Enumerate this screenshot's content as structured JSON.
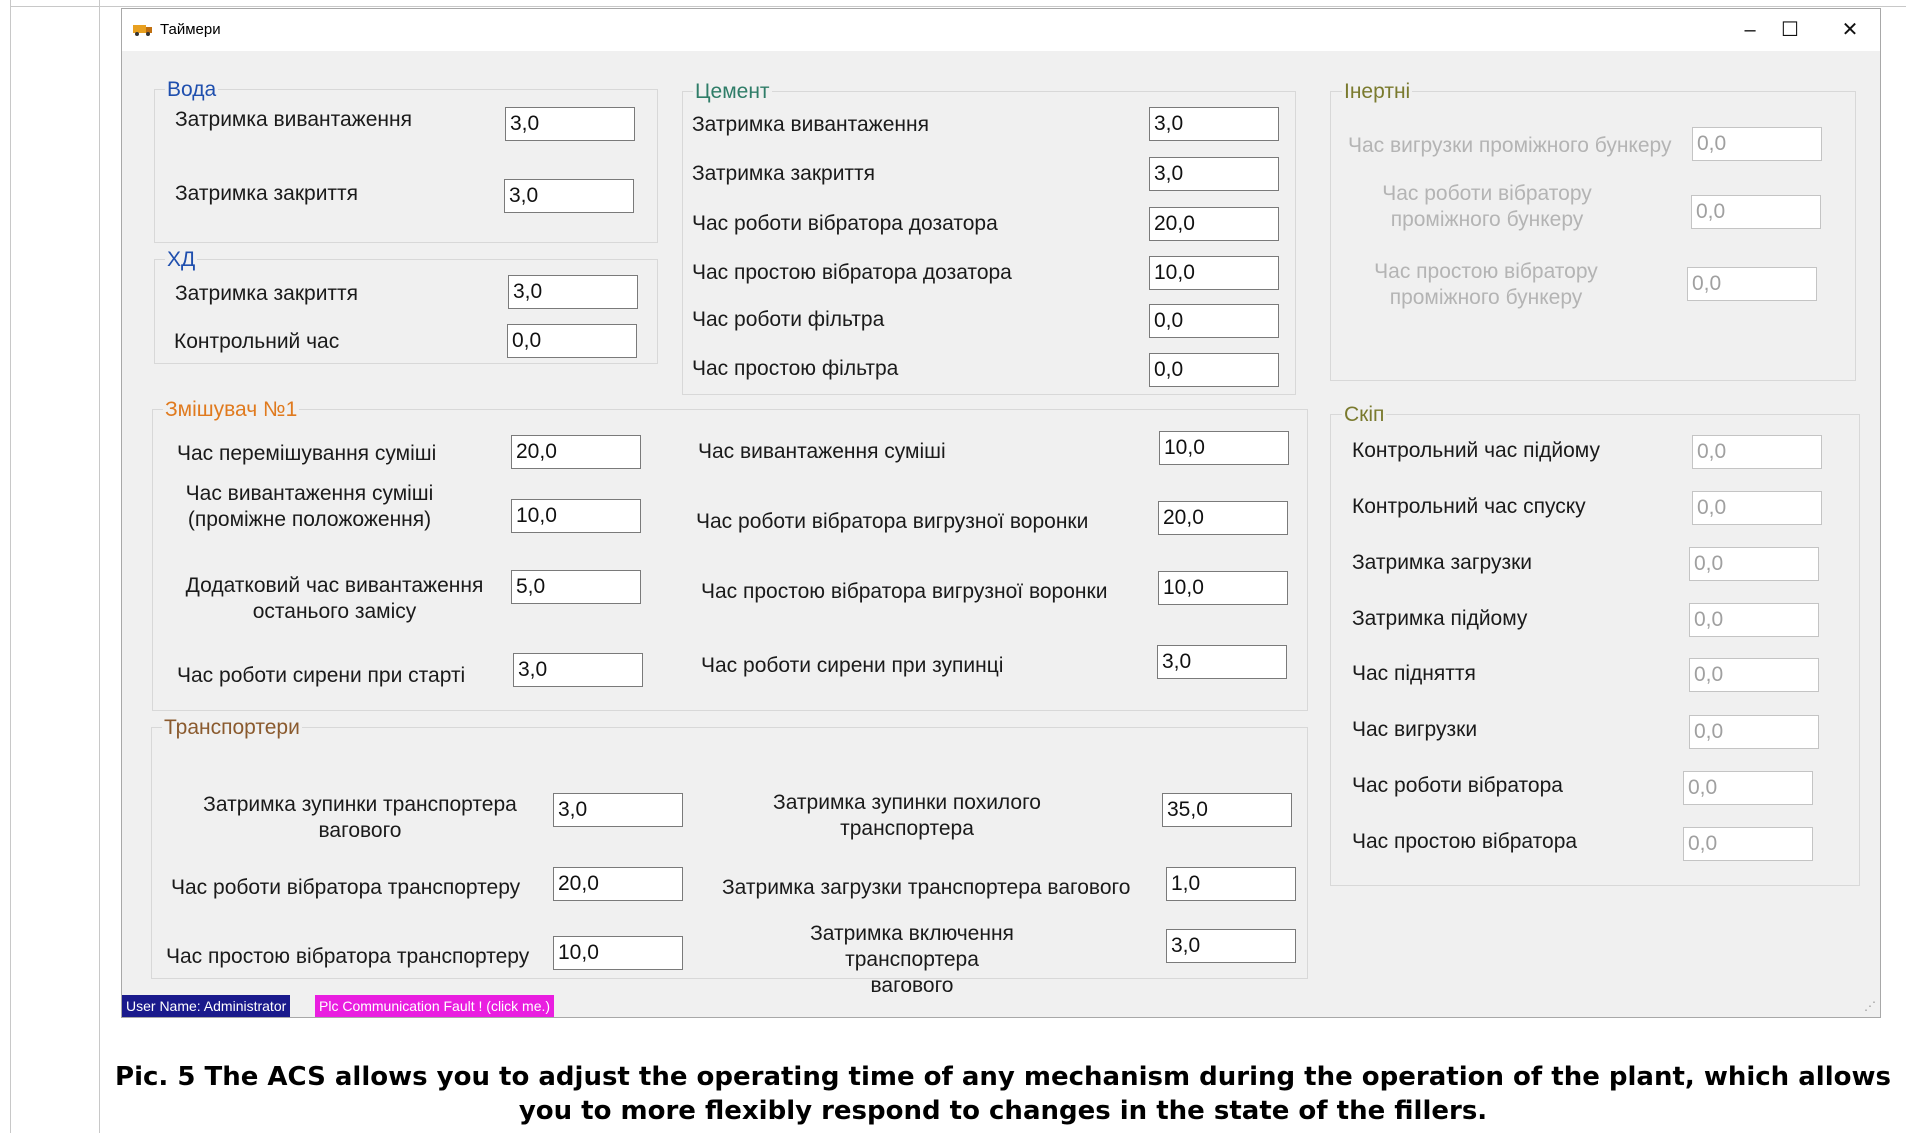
{
  "window": {
    "title": "Таймери",
    "minimize": "–",
    "maximize": "☐",
    "close": "✕"
  },
  "water": {
    "title": "Вода",
    "fields": [
      {
        "label": "Затримка вивантаження",
        "value": "3,0"
      },
      {
        "label": "Затримка закриття",
        "value": "3,0"
      }
    ]
  },
  "hd": {
    "title": "ХД",
    "fields": [
      {
        "label": "Затримка закриття",
        "value": "3,0"
      },
      {
        "label": "Контрольний час",
        "value": "0,0"
      }
    ]
  },
  "cement": {
    "title": "Цемент",
    "fields": [
      {
        "label": "Затримка вивантаження",
        "value": "3,0"
      },
      {
        "label": "Затримка закриття",
        "value": "3,0"
      },
      {
        "label": "Час роботи вібратора дозатора",
        "value": "20,0"
      },
      {
        "label": "Час простою вібратора дозатора",
        "value": "10,0"
      },
      {
        "label": "Час роботи фільтра",
        "value": "0,0"
      },
      {
        "label": "Час простою фільтра",
        "value": "0,0"
      }
    ]
  },
  "inert": {
    "title": "Інертні",
    "fields": [
      {
        "label": "Час вигрузки проміжного бункеру",
        "value": "0,0"
      },
      {
        "label1": "Час роботи вібратору",
        "label2": "проміжного бункеру",
        "value": "0,0"
      },
      {
        "label1": "Час простою вібратору",
        "label2": "проміжного бункеру",
        "value": "0,0"
      }
    ]
  },
  "mixer": {
    "title": "Змішувач №1",
    "left": [
      {
        "label": "Час перемішування суміші",
        "value": "20,0"
      },
      {
        "label1": "Час вивантаження суміші",
        "label2": "(проміжне положоження)",
        "value": "10,0"
      },
      {
        "label1": "Додатковий час вивантаження",
        "label2": "останього замісу",
        "value": "5,0"
      },
      {
        "label": "Час роботи сирени при старті",
        "value": "3,0"
      }
    ],
    "right": [
      {
        "label": "Час вивантаження суміші",
        "value": "10,0"
      },
      {
        "label": "Час роботи вібратора вигрузної воронки",
        "value": "20,0"
      },
      {
        "label": "Час простою вібратора вигрузної воронки",
        "value": "10,0"
      },
      {
        "label": "Час роботи сирени при зупинці",
        "value": "3,0"
      }
    ]
  },
  "skip": {
    "title": "Скіп",
    "fields": [
      {
        "label": "Контрольний час підйому",
        "value": "0,0"
      },
      {
        "label": "Контрольний час спуску",
        "value": "0,0"
      },
      {
        "label": "Затримка загрузки",
        "value": "0,0"
      },
      {
        "label": "Затримка підйому",
        "value": "0,0"
      },
      {
        "label": "Час підняття",
        "value": "0,0"
      },
      {
        "label": "Час вигрузки",
        "value": "0,0"
      },
      {
        "label": "Час роботи вібратора",
        "value": "0,0"
      },
      {
        "label": "Час простою вібратора",
        "value": "0,0"
      }
    ]
  },
  "conveyors": {
    "title": "Транспортери",
    "left": [
      {
        "label1": "Затримка зупинки транспортера",
        "label2": "вагового",
        "value": "3,0"
      },
      {
        "label": "Час роботи вібратора транспортеру",
        "value": "20,0"
      },
      {
        "label": "Час простою вібратора транспортеру",
        "value": "10,0"
      }
    ],
    "right": [
      {
        "label1": "Затримка зупинки похилого",
        "label2": "транспортера",
        "value": "35,0"
      },
      {
        "label": "Затримка загрузки транспортера вагового",
        "value": "1,0"
      },
      {
        "label1": "Затримка включення транспортера",
        "label2": "вагового",
        "value": "3,0"
      }
    ]
  },
  "status": {
    "user": "User Name: Administrator",
    "plc": "Plc Communication Fault ! (click me.)",
    "grip": "⋰"
  },
  "caption": {
    "line1": "Pic. 5 The ACS allows you to adjust the operating time of any mechanism during the operation of the plant, which allows",
    "line2": "you to more flexibly respond to changes in the state of the fillers."
  },
  "colors": {
    "status_user_bg": "#1a1a8c",
    "status_plc_bg": "#e91ee0",
    "window_bg": "#f0f0f0"
  }
}
